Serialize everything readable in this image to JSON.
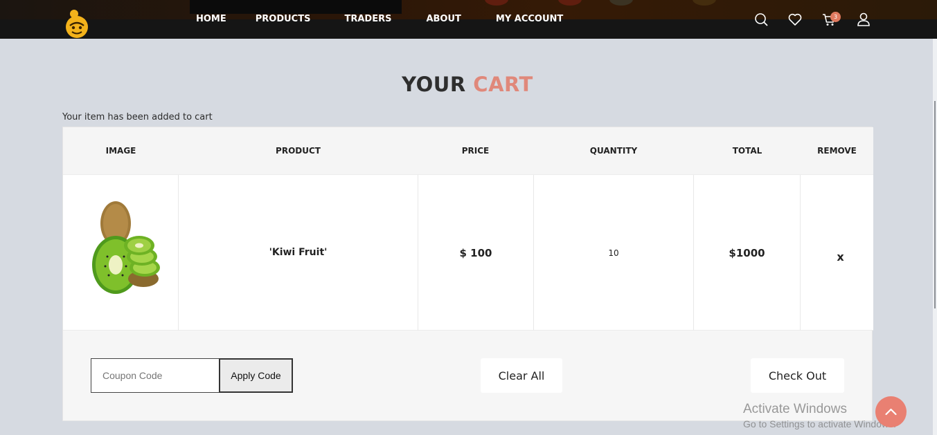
{
  "header": {
    "nav": [
      {
        "label": "HOME"
      },
      {
        "label": "PRODUCTS"
      },
      {
        "label": "TRADERS"
      },
      {
        "label": "ABOUT"
      },
      {
        "label": "MY ACCOUNT"
      }
    ],
    "icons": [
      "search-icon",
      "heart-icon",
      "cart-icon",
      "user-icon"
    ],
    "cart_count": "3"
  },
  "page": {
    "title_part1": "YOUR",
    "title_part2": "CART",
    "notice": "Your item has been added to cart"
  },
  "cart": {
    "columns": [
      "IMAGE",
      "PRODUCT",
      "PRICE",
      "QUANTITY",
      "TOTAL",
      "REMOVE"
    ],
    "items": [
      {
        "product": "'Kiwi Fruit'",
        "price": "$ 100",
        "quantity": "10",
        "total": "$1000",
        "remove": "x"
      }
    ],
    "coupon_placeholder": "Coupon Code",
    "apply_label": "Apply Code",
    "clear_label": "Clear All",
    "checkout_label": "Check Out"
  },
  "watermark": {
    "line1": "Activate Windows",
    "line2": "Go to Settings to activate Windows."
  },
  "colors": {
    "accent": "#e0887a",
    "header_bg": "#151515",
    "page_bg": "#d6dae1",
    "badge": "#e07a5f"
  }
}
